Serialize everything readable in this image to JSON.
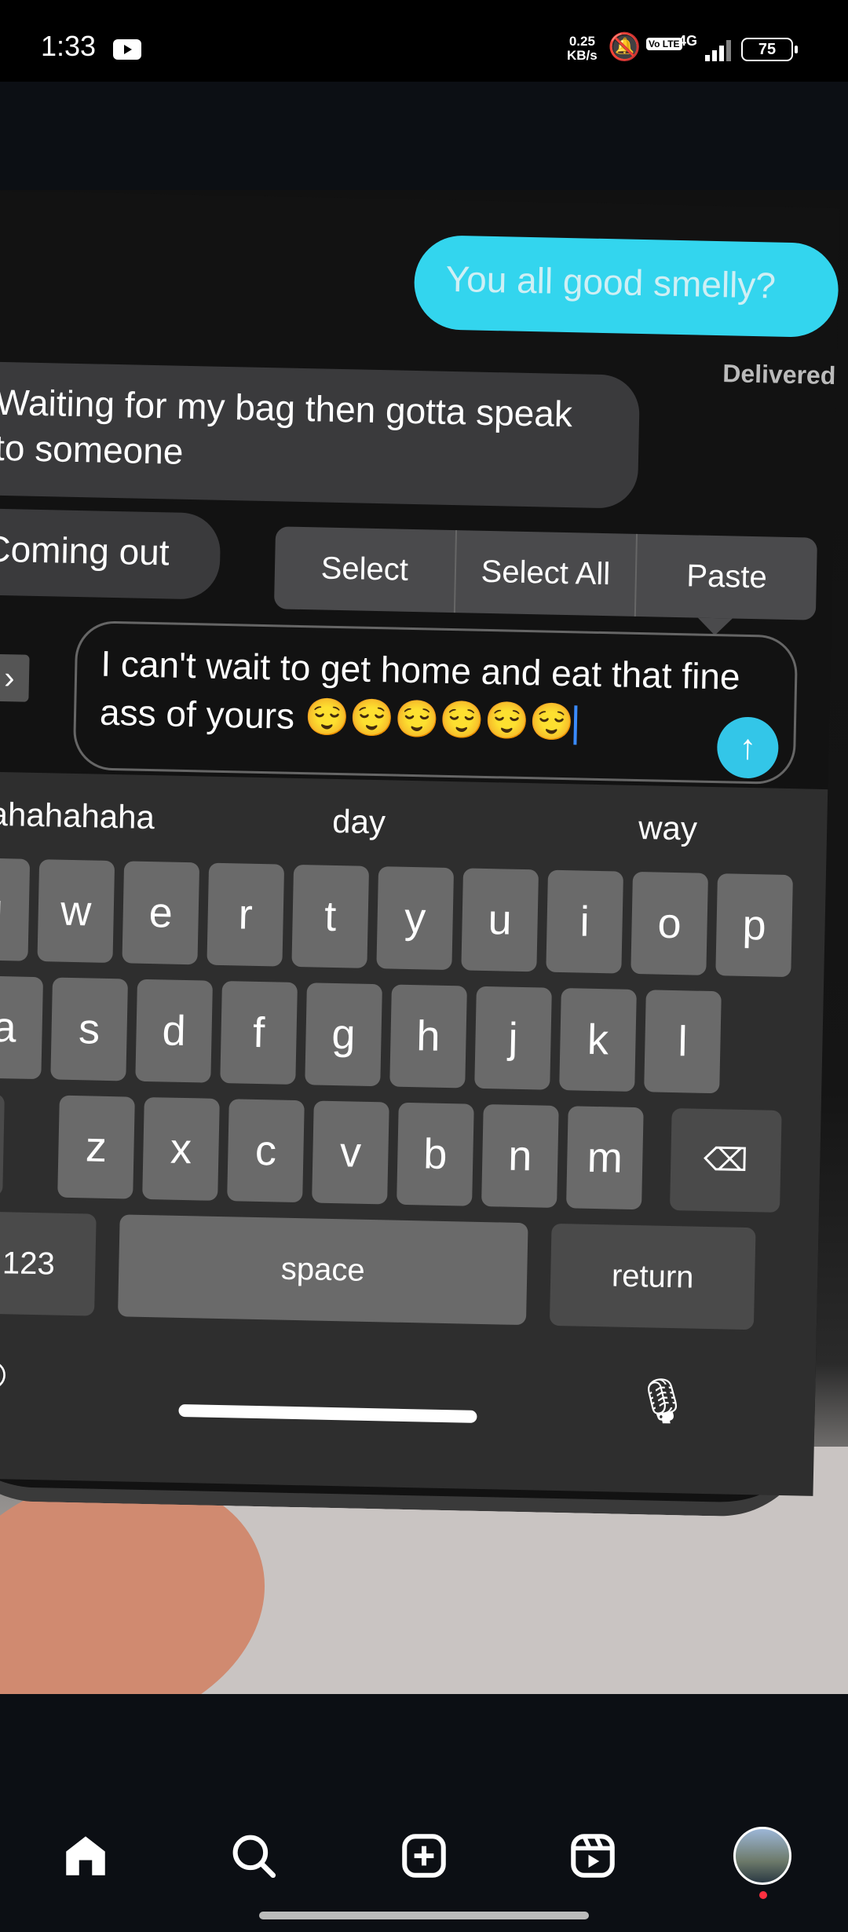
{
  "status_bar": {
    "time": "1:33",
    "speed": "0.25",
    "speed_unit": "KB/s",
    "volte": "Vo LTE",
    "network": "4G",
    "battery": "75"
  },
  "chat": {
    "sent_message": "You all good smelly?",
    "delivered": "Delivered",
    "received_1": "Waiting for my bag then gotta speak to someone",
    "received_2": "Coming out"
  },
  "context_menu": {
    "select": "Select",
    "select_all": "Select All",
    "paste": "Paste"
  },
  "input": {
    "text": "I can't wait to get home and eat that fine ass of yours 😌😌😌😌😌😌"
  },
  "keyboard": {
    "suggestions": [
      "hahahahaha",
      "day",
      "way"
    ],
    "row1": [
      "q",
      "w",
      "e",
      "r",
      "t",
      "y",
      "u",
      "i",
      "o",
      "p"
    ],
    "row2": [
      "a",
      "s",
      "d",
      "f",
      "g",
      "h",
      "j",
      "k",
      "l"
    ],
    "row3": [
      "z",
      "x",
      "c",
      "v",
      "b",
      "n",
      "m"
    ],
    "numbers": "123",
    "space": "space",
    "return": "return"
  },
  "bottom_nav": {
    "items": [
      "home-icon",
      "search-icon",
      "create-icon",
      "reels-icon",
      "profile-avatar"
    ]
  }
}
